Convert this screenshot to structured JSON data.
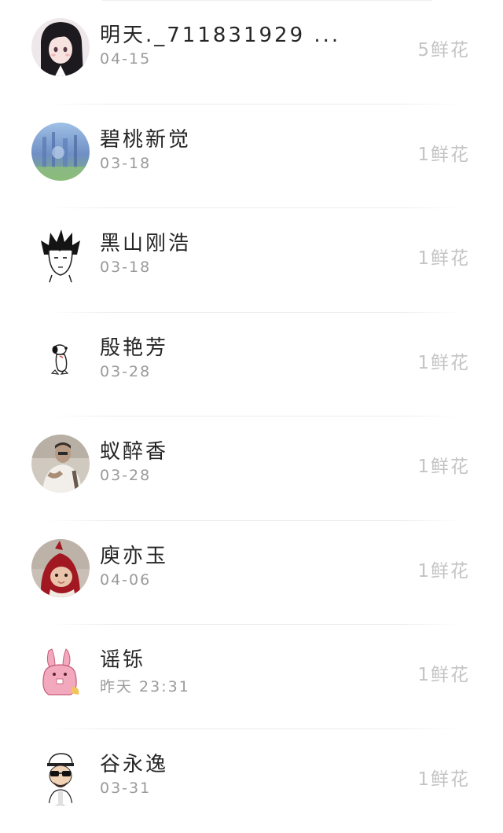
{
  "items": [
    {
      "name": "明天._711831929 ...",
      "date": "04-15",
      "flowers": "5鲜花",
      "avatar_icon": "anime-girl-avatar-icon"
    },
    {
      "name": "碧桃新觉",
      "date": "03-18",
      "flowers": "1鲜花",
      "avatar_icon": "blue-landscape-avatar-icon"
    },
    {
      "name": "黑山刚浩",
      "date": "03-18",
      "flowers": "1鲜花",
      "avatar_icon": "sketch-boy-avatar-icon"
    },
    {
      "name": "殷艳芳",
      "date": "03-28",
      "flowers": "1鲜花",
      "avatar_icon": "snoopy-avatar-icon"
    },
    {
      "name": "蚁醉香",
      "date": "03-28",
      "flowers": "1鲜花",
      "avatar_icon": "photo-man-avatar-icon"
    },
    {
      "name": "庾亦玉",
      "date": "04-06",
      "flowers": "1鲜花",
      "avatar_icon": "red-hood-baby-avatar-icon"
    },
    {
      "name": "谣铄",
      "date": "昨天 23:31",
      "flowers": "1鲜花",
      "avatar_icon": "pink-rabbit-avatar-icon"
    },
    {
      "name": "谷永逸",
      "date": "03-31",
      "flowers": "1鲜花",
      "avatar_icon": "cartoon-man-avatar-icon"
    }
  ],
  "colors": {
    "name": "#262626",
    "date": "#9a9a9a",
    "flowers": "#c4c4c4",
    "divider": "#ececec"
  }
}
